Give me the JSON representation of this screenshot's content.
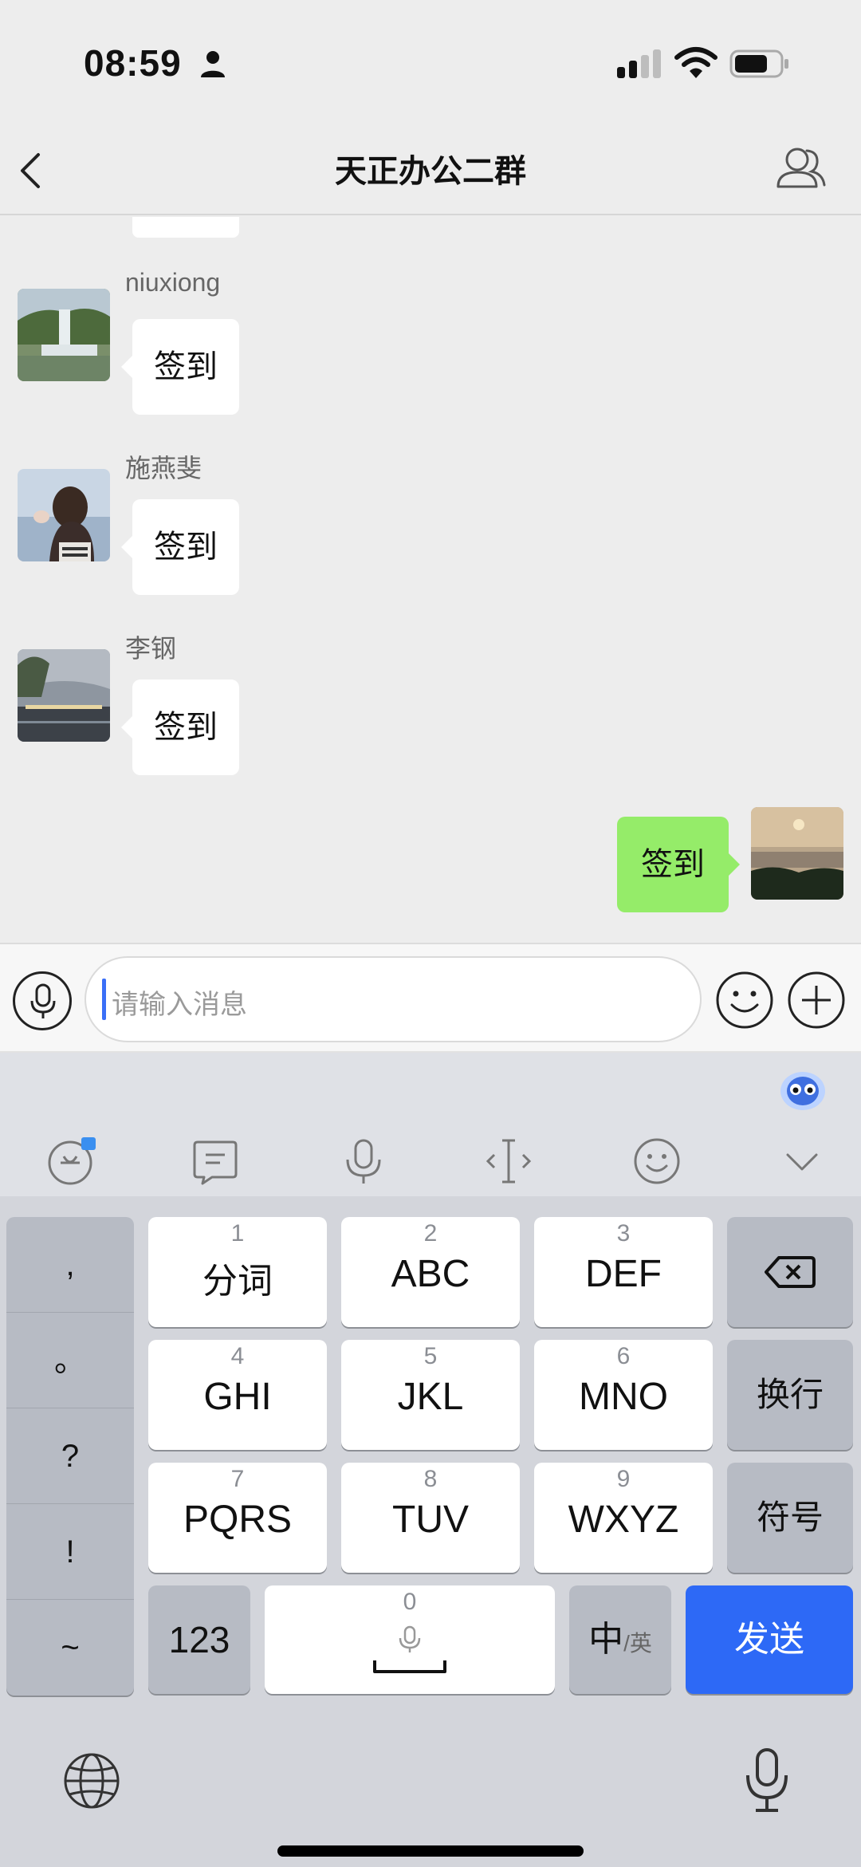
{
  "status_bar": {
    "time": "08:59"
  },
  "nav": {
    "title": "天正办公二群"
  },
  "messages": [
    {
      "sender": "niuxiong",
      "text": "签到"
    },
    {
      "sender": "施燕斐",
      "text": "签到"
    },
    {
      "sender": "李钢",
      "text": "签到"
    },
    {
      "sender": "me",
      "text": "签到"
    }
  ],
  "input": {
    "placeholder": "请输入消息"
  },
  "keyboard": {
    "punctuation": [
      ",",
      "。",
      "?",
      "!",
      "~"
    ],
    "keys": [
      {
        "digit": "1",
        "letters": "分词"
      },
      {
        "digit": "2",
        "letters": "ABC"
      },
      {
        "digit": "3",
        "letters": "DEF"
      },
      {
        "digit": "4",
        "letters": "GHI"
      },
      {
        "digit": "5",
        "letters": "JKL"
      },
      {
        "digit": "6",
        "letters": "MNO"
      },
      {
        "digit": "7",
        "letters": "PQRS"
      },
      {
        "digit": "8",
        "letters": "TUV"
      },
      {
        "digit": "9",
        "letters": "WXYZ"
      }
    ],
    "newline_label": "换行",
    "symbols_label": "符号",
    "numbers_label": "123",
    "space_digit": "0",
    "lang_main": "中",
    "lang_alt": "/英",
    "send_label": "发送"
  },
  "colors": {
    "accent": "#2d69f6",
    "outgoing_bubble": "#95ec69",
    "cursor": "#3a6ff7"
  },
  "icons": [
    "person-icon",
    "signal-icon",
    "wifi-icon",
    "battery-icon",
    "back-icon",
    "members-icon",
    "microphone-icon",
    "emoji-icon",
    "add-icon",
    "globe-icon",
    "backspace-icon"
  ]
}
